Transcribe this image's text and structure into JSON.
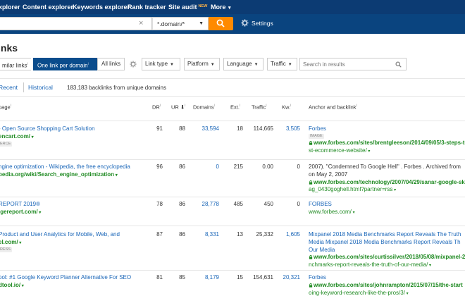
{
  "nav": {
    "items": [
      {
        "label": "xplorer"
      },
      {
        "label": "Content explorer"
      },
      {
        "label": "Keywords explorer"
      },
      {
        "label": "Rank tracker"
      },
      {
        "label": "Site audit",
        "badge": "NEW"
      },
      {
        "label": "More"
      }
    ]
  },
  "search": {
    "value": "",
    "mode": "*.domain/*",
    "settings_label": "Settings"
  },
  "page_title": "inks",
  "filters": {
    "segments": [
      "milar links",
      "One link per domain",
      "All links"
    ],
    "dropdowns": [
      "Link type",
      "Platform",
      "Language",
      "Traffic"
    ],
    "results_placeholder": "Search in results"
  },
  "tabs": {
    "recent": "Recent",
    "historical": "Historical"
  },
  "summary": "183,183 backlinks from unique domains",
  "columns": {
    "page": "page",
    "dr": "DR",
    "ur": "UR",
    "domains": "Domains",
    "ext": "Ext.",
    "traffic": "Traffic",
    "kw": "Kw.",
    "anchor": "Anchor and backlink"
  },
  "rows": [
    {
      "title": "- Open Source Shopping Cart Solution",
      "url": "encart.com/",
      "tag": "ERCE",
      "dr": "91",
      "ur": "88",
      "domains": "33,594",
      "ext": "18",
      "traffic": "114,665",
      "kw": "3,505",
      "anchor_lines": [
        {
          "text": "Forbes",
          "style": "blue"
        },
        {
          "text": "IMAGE",
          "style": "tag"
        },
        {
          "text": "www.forbes.com/sites/brentgleeson/2014/09/05/3-steps-to-",
          "style": "link"
        },
        {
          "text": "st-ecommerce-website/",
          "style": "greenlink"
        }
      ]
    },
    {
      "title": "ngine optimization - Wikipedia, the free encyclopedia",
      "url": "pedia.org/wiki/Search_engine_optimization",
      "tag": "",
      "dr": "96",
      "ur": "86",
      "domains": "0",
      "ext": "215",
      "traffic": "0.00",
      "kw": "0",
      "anchor_lines": [
        {
          "text": "2007). \"Condemned To Google Hell\" . Forbes . Archived from",
          "style": "dark"
        },
        {
          "text": "on May 2, 2007",
          "style": "dark"
        },
        {
          "text": "www.forbes.com/technology/2007/04/29/sanar-google-skyf",
          "style": "link"
        },
        {
          "text": "ag_0430goghell.html?partner=rss",
          "style": "greenlink"
        }
      ]
    },
    {
      "title": "REPORT 2019®",
      "url": "lgereport.com/",
      "tag": "",
      "dr": "78",
      "ur": "86",
      "domains": "28,778",
      "ext": "485",
      "traffic": "450",
      "kw": "0",
      "anchor_lines": [
        {
          "text": "FORBES",
          "style": "blue"
        },
        {
          "text": "www.forbes.com/",
          "style": "greenlink"
        }
      ]
    },
    {
      "title": "Product and User Analytics for Mobile, Web, and",
      "url": "el.com/",
      "tag": "RESS",
      "dr": "87",
      "ur": "86",
      "domains": "8,331",
      "ext": "13",
      "traffic": "25,332",
      "kw": "1,605",
      "anchor_lines": [
        {
          "text": "Mixpanel 2018 Media Benchmarks Report Reveals The Truth",
          "style": "blue"
        },
        {
          "text": "Media Mixpanel 2018 Media Benchmarks Report Reveals Th",
          "style": "blue"
        },
        {
          "text": "Our Media",
          "style": "blue"
        },
        {
          "text": "www.forbes.com/sites/curtissilver/2018/05/08/mixpanel-2",
          "style": "link"
        },
        {
          "text": "nchmarks-report-reveals-the-truth-of-our-media/",
          "style": "greenlink"
        }
      ]
    },
    {
      "title": "ool: #1 Google Keyword Planner Alternative For SEO",
      "url": "dtool.io/",
      "tag": "",
      "dr": "81",
      "ur": "85",
      "domains": "8,179",
      "ext": "15",
      "traffic": "154,631",
      "kw": "20,321",
      "anchor_lines": [
        {
          "text": "Forbes",
          "style": "blue"
        },
        {
          "text": "www.forbes.com/sites/johnrampton/2015/07/15/the-start",
          "style": "link"
        },
        {
          "text": "oing-keyword-research-like-the-pros/3/",
          "style": "greenlink"
        }
      ]
    }
  ]
}
